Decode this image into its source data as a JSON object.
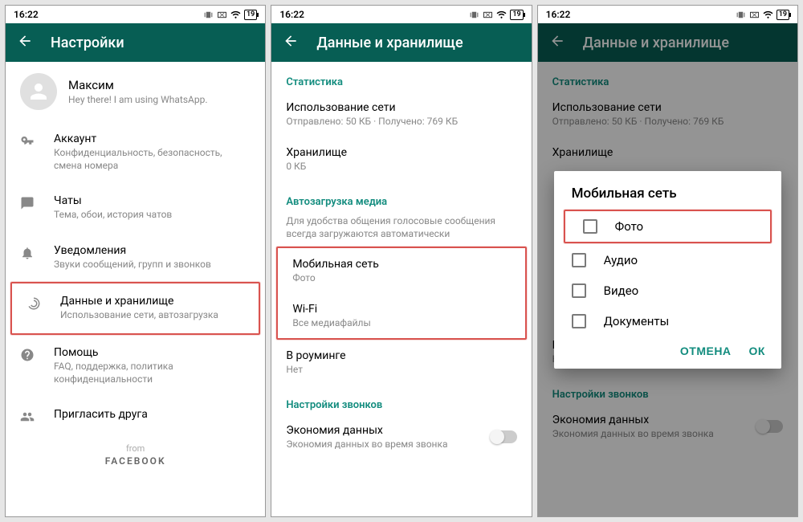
{
  "statusbar": {
    "time": "16:22",
    "battery": "19"
  },
  "screen1": {
    "title": "Настройки",
    "profile": {
      "name": "Максим",
      "status": "Hey there! I am using WhatsApp."
    },
    "items": [
      {
        "icon": "key",
        "title": "Аккаунт",
        "sub": "Конфиденциальность, безопасность, смена номера"
      },
      {
        "icon": "chat",
        "title": "Чаты",
        "sub": "Тема, обои, история чатов"
      },
      {
        "icon": "bell",
        "title": "Уведомления",
        "sub": "Звуки сообщений, групп и звонков"
      },
      {
        "icon": "data",
        "title": "Данные и хранилище",
        "sub": "Использование сети, автозагрузка"
      },
      {
        "icon": "help",
        "title": "Помощь",
        "sub": "FAQ, поддержка, политика конфиденциальности"
      },
      {
        "icon": "invite",
        "title": "Пригласить друга",
        "sub": ""
      }
    ],
    "footer": {
      "from": "from",
      "brand": "FACEBOOK"
    }
  },
  "screen2": {
    "title": "Данные и хранилище",
    "sections": {
      "stats": {
        "label": "Статистика",
        "network": {
          "title": "Использование сети",
          "sub": "Отправлено: 50 КБ · Получено: 769 КБ"
        },
        "storage": {
          "title": "Хранилище",
          "sub": "0 КБ"
        }
      },
      "autoload": {
        "label": "Автозагрузка медиа",
        "desc": "Для удобства общения голосовые сообщения всегда загружаются автоматически",
        "mobile": {
          "title": "Мобильная сеть",
          "sub": "Фото"
        },
        "wifi": {
          "title": "Wi-Fi",
          "sub": "Все медиафайлы"
        },
        "roaming": {
          "title": "В роуминге",
          "sub": "Нет"
        }
      },
      "calls": {
        "label": "Настройки звонков",
        "econ": {
          "title": "Экономия данных",
          "sub": "Экономия данных во время звонка"
        }
      }
    }
  },
  "screen3": {
    "dialog": {
      "title": "Мобильная сеть",
      "options": [
        "Фото",
        "Аудио",
        "Видео",
        "Документы"
      ],
      "cancel": "ОТМЕНА",
      "ok": "ОК"
    }
  }
}
